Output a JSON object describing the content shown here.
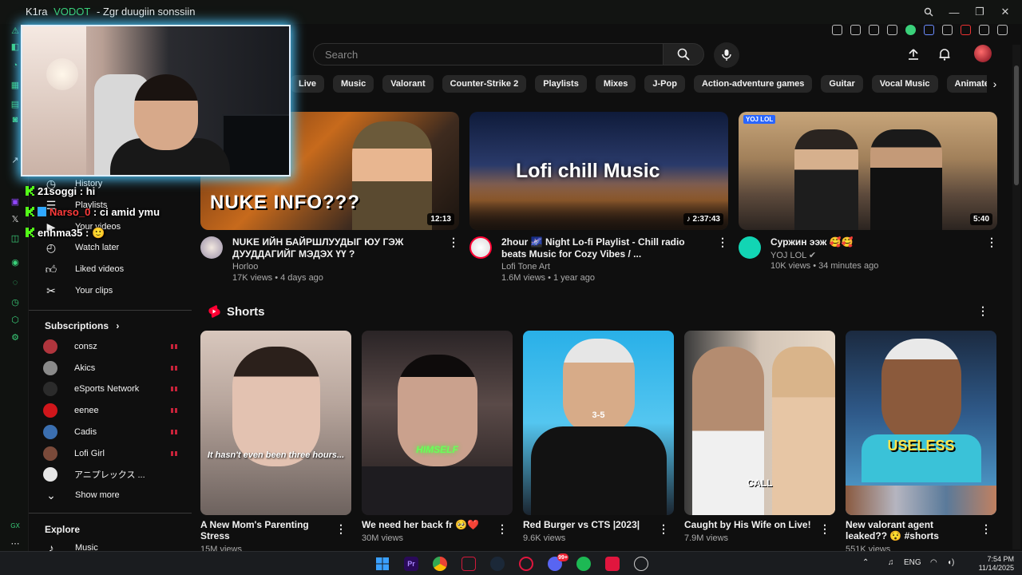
{
  "window": {
    "title_name": "K1ra",
    "title_badge": "VODOT",
    "title_rest": "- Zgr duugiin sonssiin"
  },
  "search": {
    "placeholder": "Search"
  },
  "chips": [
    "Live",
    "Music",
    "Valorant",
    "Counter-Strike 2",
    "Playlists",
    "Mixes",
    "J-Pop",
    "Action-adventure games",
    "Guitar",
    "Vocal Music",
    "Animated film"
  ],
  "nav": {
    "history": "History",
    "playlists": "Playlists",
    "your_videos": "Your videos",
    "watch_later": "Watch later",
    "liked_videos": "Liked videos",
    "your_clips": "Your clips",
    "subscriptions": "Subscriptions",
    "show_more": "Show more",
    "explore": "Explore",
    "music": "Music"
  },
  "subscriptions": [
    {
      "name": "consz",
      "color": "#b0353d"
    },
    {
      "name": "Akics",
      "color": "#8a8a8a"
    },
    {
      "name": "eSports Network",
      "color": "#2b2b2b"
    },
    {
      "name": "eenee",
      "color": "#d0161b"
    },
    {
      "name": "Cadis",
      "color": "#3b6fb0"
    },
    {
      "name": "Lofi Girl",
      "color": "#7a4a3a"
    },
    {
      "name": "アニプレックス ...",
      "color": "#e6e6e6"
    }
  ],
  "chat": [
    {
      "user": "21soggi",
      "sep": " : ",
      "msg": "hi",
      "user_color": "#ffffff"
    },
    {
      "user": "Narso_0",
      "sep": " : ",
      "msg": "ci amid ymu",
      "user_color": "#ff3b3b"
    },
    {
      "user": "enhma35",
      "sep": " : ",
      "msg": "🙂",
      "user_color": "#ffffff"
    }
  ],
  "videos": [
    {
      "title": "NUKE ИЙН БАЙРШЛУУДЫГ ЮУ ГЭЖ ДУУДДАГИЙГ МЭДЭХ ҮҮ ?",
      "channel": "Horloo",
      "stats": "17K views • 4 days ago",
      "duration": "12:13",
      "thumb_text": "NUKE INFO???"
    },
    {
      "title": "2hour 🌌 Night Lo-fi Playlist - Chill radio beats Music for Cozy Vibes / ...",
      "channel": "Lofi Tone Art",
      "stats": "1.6M views • 1 year ago",
      "duration": "♪ 2:37:43",
      "thumb_text": "Lofi chill Music"
    },
    {
      "title": "Суржин ээж 🥰🥰",
      "channel": "YOJ LOL",
      "stats": "10K views • 34 minutes ago",
      "duration": "5:40",
      "thumb_text": "YOJ LOL"
    }
  ],
  "shorts_header": "Shorts",
  "shorts": [
    {
      "title": "A New Mom's Parenting Stress",
      "views": "15M views",
      "caption": "It hasn't even been three hours..."
    },
    {
      "title": "We need her back fr 🥺❤️",
      "views": "30M views",
      "caption": "HIMSELF"
    },
    {
      "title": "Red Burger vs CTS |2023|",
      "views": "9.6K views",
      "caption": "3-5"
    },
    {
      "title": "Caught by His Wife on Live!",
      "views": "7.9M views",
      "caption": "CALL"
    },
    {
      "title": "New valorant agent leaked?? 😯 #shorts",
      "views": "551K views",
      "caption": "USELESS"
    }
  ],
  "taskbar": {
    "lang": "ENG",
    "time": "7:54 PM",
    "date": "11/14/2025",
    "discord_badge": "99+"
  },
  "colors": {
    "accent_red": "#ff0033",
    "rail_green": "#3ad07a",
    "cam_glow": "#4ec9ff"
  }
}
